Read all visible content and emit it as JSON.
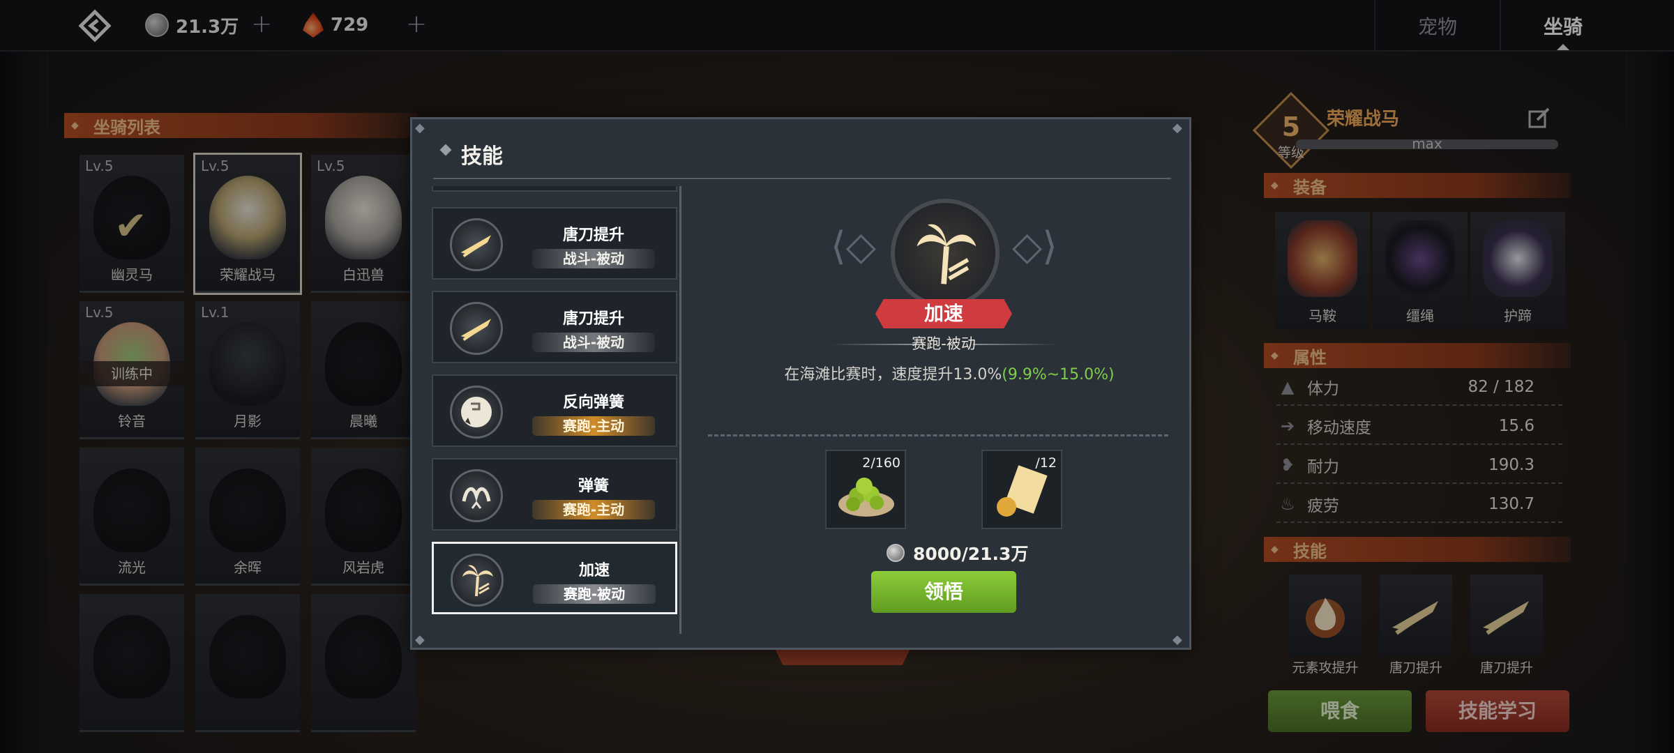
{
  "topbar": {
    "currency_silver": "21.3万",
    "currency_gem": "729",
    "tabs": [
      {
        "label": "宠物",
        "active": false
      },
      {
        "label": "坐骑",
        "active": true
      }
    ]
  },
  "mount_list": {
    "title": "坐骑列表",
    "mounts": [
      {
        "level": "Lv.5",
        "name": "幽灵马",
        "status": "equipped"
      },
      {
        "level": "Lv.5",
        "name": "荣耀战马",
        "status": "selected"
      },
      {
        "level": "Lv.5",
        "name": "白迅兽",
        "status": "owned"
      },
      {
        "level": "Lv.5",
        "name": "铃音",
        "status": "training",
        "tag": "训练中"
      },
      {
        "level": "Lv.1",
        "name": "月影",
        "status": "owned"
      },
      {
        "level": "",
        "name": "晨曦",
        "status": "locked"
      },
      {
        "level": "",
        "name": "流光",
        "status": "locked"
      },
      {
        "level": "",
        "name": "余晖",
        "status": "locked"
      },
      {
        "level": "",
        "name": "风岩虎",
        "status": "locked"
      },
      {
        "level": "",
        "name": "",
        "status": "locked"
      },
      {
        "level": "",
        "name": "",
        "status": "locked"
      },
      {
        "level": "",
        "name": "",
        "status": "locked"
      }
    ]
  },
  "mount_info": {
    "level": "5",
    "level_label": "等级",
    "name": "荣耀战马",
    "exp_text": "max"
  },
  "equipment": {
    "title": "装备",
    "items": [
      {
        "name": "马鞍"
      },
      {
        "name": "缰绳"
      },
      {
        "name": "护蹄"
      }
    ]
  },
  "attributes": {
    "title": "属性",
    "rows": [
      {
        "label": "体力",
        "value": "82 / 182",
        "icon": "stamina-icon"
      },
      {
        "label": "移动速度",
        "value": "15.6",
        "icon": "speed-icon"
      },
      {
        "label": "耐力",
        "value": "190.3",
        "icon": "endurance-icon"
      },
      {
        "label": "疲劳",
        "value": "130.7",
        "icon": "fatigue-icon"
      }
    ]
  },
  "skills_panel": {
    "title": "技能",
    "slots": [
      {
        "name": "元素攻提升",
        "icon": "fire-icon"
      },
      {
        "name": "唐刀提升",
        "icon": "blade-icon"
      },
      {
        "name": "唐刀提升",
        "icon": "blade-icon"
      }
    ],
    "feed_label": "喂食",
    "learn_label": "技能学习"
  },
  "modal": {
    "title": "技能",
    "list": [
      {
        "name": "唐刀提升",
        "tag": "战斗-被动",
        "tag_type": "battle",
        "icon": "blade-icon"
      },
      {
        "name": "唐刀提升",
        "tag": "战斗-被动",
        "tag_type": "battle",
        "icon": "blade-icon"
      },
      {
        "name": "反向弹簧",
        "tag": "赛跑-主动",
        "tag_type": "race-active",
        "icon": "reverse-spring-icon"
      },
      {
        "name": "弹簧",
        "tag": "赛跑-主动",
        "tag_type": "race-active",
        "icon": "spring-icon"
      },
      {
        "name": "加速",
        "tag": "赛跑-被动",
        "tag_type": "race-passive",
        "icon": "palm-tree-icon",
        "selected": true
      }
    ],
    "detail": {
      "name": "加速",
      "type": "赛跑-被动",
      "desc_main": "在海滩比赛时，速度提升13.0%",
      "desc_range": "(9.9%~15.0%)",
      "materials": [
        {
          "count": "2/160",
          "icon": "green-fruit-icon"
        },
        {
          "count": "/12",
          "icon": "scroll-icon"
        }
      ],
      "cost": "8000/21.3万",
      "button_label": "领悟"
    }
  },
  "colors": {
    "accent_orange": "#b34d24",
    "accent_green": "#7fcf4a",
    "accent_red": "#cf3b3f"
  }
}
